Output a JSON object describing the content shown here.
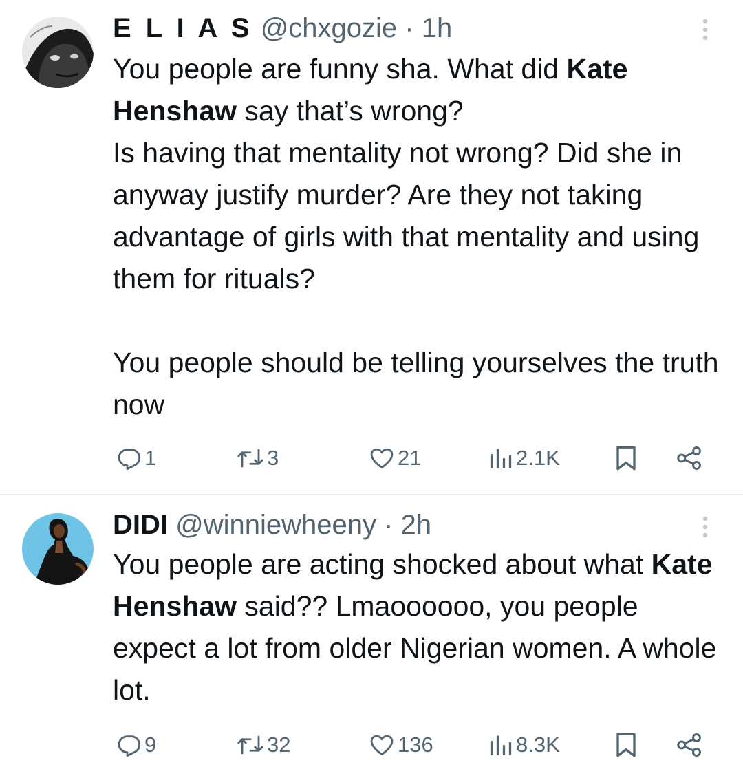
{
  "tweets": [
    {
      "name": "E L I A S",
      "handle": "@chxgozie",
      "dot": "·",
      "time": "1h",
      "body": {
        "l1a": "You people are funny sha. What did ",
        "l1b": "Kate Henshaw",
        "l1c": " say that’s wrong?",
        "l2": "Is having that mentality not wrong? Did she in anyway justify murder? Are they not taking advantage of girls with that mentality and using them for rituals?",
        "l3": "You people should be telling yourselves the truth now"
      },
      "stats": {
        "replies": "1",
        "reposts": "3",
        "likes": "21",
        "views": "2.1K"
      }
    },
    {
      "name": "DIDI",
      "handle": "@winniewheeny",
      "dot": "·",
      "time": "2h",
      "body": {
        "l1a": "You people are acting shocked about what ",
        "l1b": "Kate Henshaw",
        "l1c": " said?? Lmaoooooo, you people expect a lot from older Nigerian women.  A whole lot."
      },
      "stats": {
        "replies": "9",
        "reposts": "32",
        "likes": "136",
        "views": "8.3K"
      }
    }
  ],
  "icons": {
    "reply": "reply-icon",
    "repost": "repost-icon",
    "like": "heart-icon",
    "views": "views-chart-icon",
    "bookmark": "bookmark-icon",
    "share": "share-icon",
    "more": "more-vertical-icon"
  },
  "colors": {
    "text": "#0f1419",
    "muted": "#536471",
    "divider": "#e6e9ec",
    "avatar2_bg": "#6ec3e6"
  }
}
